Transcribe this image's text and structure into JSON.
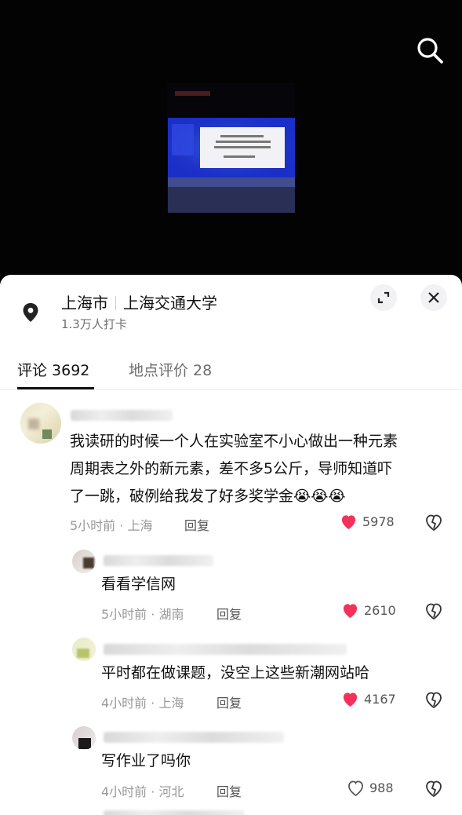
{
  "header": {
    "search_icon": "search-icon"
  },
  "location": {
    "city": "上海市",
    "place": "上海交通大学",
    "checkins": "1.3万人打卡",
    "icons": {
      "pin": "location-pin-icon",
      "expand": "expand-icon",
      "close": "close-icon"
    }
  },
  "tabs": [
    {
      "label": "评论 3692",
      "active": true
    },
    {
      "label": "地点评价 28",
      "active": false
    }
  ],
  "comments": [
    {
      "text_lines": [
        "我读研的时候一个人在实验室不小心做出一种元素",
        "周期表之外的新元素，差不多5公斤，导师知道吓",
        "了一跳，破例给我发了好多奖学金"
      ],
      "emoji": "😭😭😭",
      "meta": "5小时前 · 上海",
      "reply_label": "回复",
      "likes": "5978",
      "liked": true
    }
  ],
  "replies": [
    {
      "text": "看看学信网",
      "meta": "5小时前 · 湖南",
      "reply_label": "回复",
      "likes": "2610",
      "liked": true
    },
    {
      "text": "平时都在做课题，没空上这些新潮网站哈",
      "meta": "4小时前 · 上海",
      "reply_label": "回复",
      "likes": "4167",
      "liked": true
    },
    {
      "text": "写作业了吗你",
      "meta": "4小时前 · 河北",
      "reply_label": "回复",
      "likes": "988",
      "liked": false
    }
  ],
  "colors": {
    "like_red": "#f2325a",
    "text": "#111111",
    "meta": "#999999"
  }
}
